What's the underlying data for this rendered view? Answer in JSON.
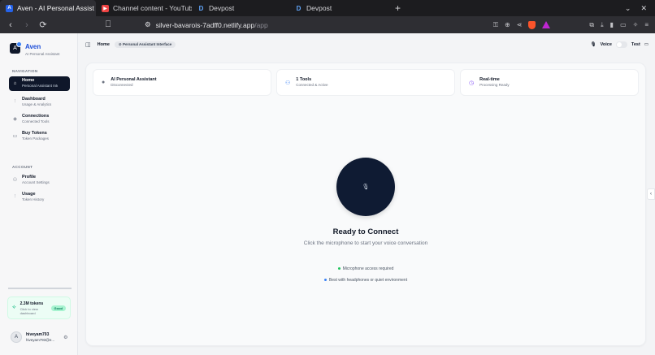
{
  "browser": {
    "tabs": [
      {
        "title": "Aven - AI Personal Assist",
        "favicon": "A",
        "kind": "aven",
        "active": true
      },
      {
        "title": "Channel content - YouTube",
        "favicon": "▶",
        "kind": "yt",
        "active": false
      },
      {
        "title": "Devpost",
        "favicon": "D",
        "kind": "dev",
        "active": false
      },
      {
        "title": "Devpost",
        "favicon": "D",
        "kind": "dev",
        "active": false
      }
    ],
    "new_tab": "+",
    "url_host": "silver-bavarois-7adff0.netlify.app",
    "url_path": "/app"
  },
  "sidebar": {
    "brand_name": "Aven",
    "brand_sub": "AI Personal Assistant",
    "nav_label": "NAVIGATION",
    "nav_items": [
      {
        "title": "Home",
        "sub": "Personal Assistant Interface",
        "icon": "home-icon"
      },
      {
        "title": "Dashboard",
        "sub": "Usage & Analytics",
        "icon": "chart-icon"
      },
      {
        "title": "Connections",
        "sub": "Connected Tools",
        "icon": "link-icon"
      },
      {
        "title": "Buy Tokens",
        "sub": "Token Packages",
        "icon": "card-icon"
      }
    ],
    "account_label": "ACCOUNT",
    "account_items": [
      {
        "title": "Profile",
        "sub": "Account Settings",
        "icon": "user-icon"
      },
      {
        "title": "Usage",
        "sub": "Token History",
        "icon": "chart-icon"
      }
    ],
    "tokens": {
      "title": "2.3M tokens",
      "sub": "Click to view dashboard",
      "badge": "Good"
    },
    "user": {
      "initial": "A",
      "name": "hiveyam793",
      "email": "hiveyam793@e..."
    }
  },
  "header": {
    "home": "Home",
    "crumb": "Personal Assistant Interface",
    "voice_label": "Voice",
    "test_label": "Test"
  },
  "stats": [
    {
      "title": "AI Personal Assistant",
      "sub": "Disconnected",
      "icon": "status-dot-icon",
      "color": "#6b7280"
    },
    {
      "title": "1 Tools",
      "sub": "Connected & Active",
      "icon": "users-icon",
      "color": "#3b82f6"
    },
    {
      "title": "Real-time",
      "sub": "Processing Ready",
      "icon": "clock-icon",
      "color": "#8b5cf6"
    }
  ],
  "main": {
    "ready_title": "Ready to Connect",
    "ready_sub": "Click the microphone to start your voice conversation",
    "hints": [
      {
        "text": "Microphone access required",
        "color": "#22c55e"
      },
      {
        "text": "Best with headphones or quiet environment",
        "color": "#3b82f6"
      }
    ]
  }
}
